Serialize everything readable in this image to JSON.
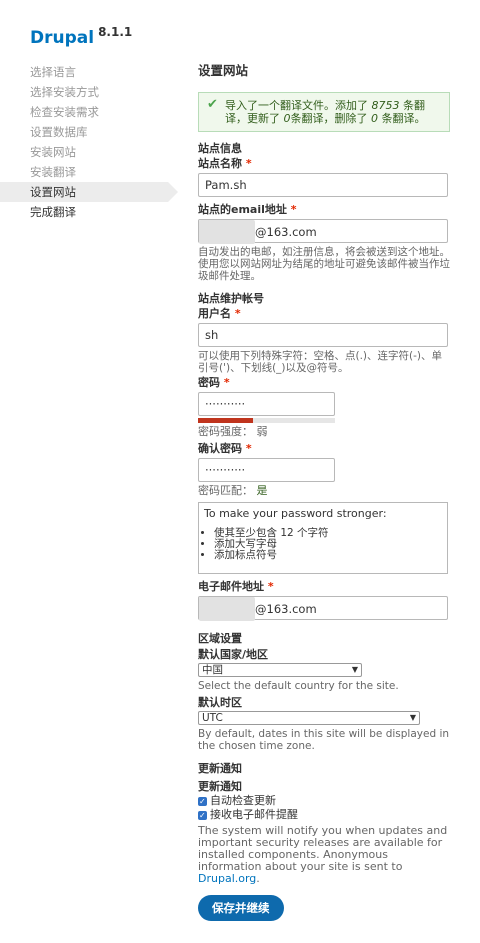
{
  "brand": {
    "name": "Drupal",
    "version": "8.1.1"
  },
  "steps": [
    {
      "label": "选择语言",
      "state": "done"
    },
    {
      "label": "选择安装方式",
      "state": "done"
    },
    {
      "label": "检查安装需求",
      "state": "done"
    },
    {
      "label": "设置数据库",
      "state": "done"
    },
    {
      "label": "安装网站",
      "state": "done"
    },
    {
      "label": "安装翻译",
      "state": "done"
    },
    {
      "label": "设置网站",
      "state": "active"
    },
    {
      "label": "完成翻译",
      "state": "todo"
    }
  ],
  "page": {
    "title": "设置网站"
  },
  "message": {
    "part1": "导入了一个翻译文件。添加了 ",
    "added": "8753",
    "part2": " 条翻译，更新了 ",
    "updated": "0",
    "part3": "条翻译，删除了 ",
    "deleted": "0",
    "part4": " 条翻译。"
  },
  "site_info": {
    "section": "站点信息",
    "name_label": "站点名称",
    "name_value": "Pam.sh",
    "email_label": "站点的email地址",
    "email_value": "@163.com",
    "email_desc": "自动发出的电邮，如注册信息，将会被送到这个地址。使用您以网站网址为结尾的地址可避免该邮件被当作垃圾邮件处理。"
  },
  "account": {
    "section": "站点维护帐号",
    "username_label": "用户名",
    "username_value": "sh",
    "username_desc": "可以使用下列特殊字符：空格、点(.)、连字符(-)、单引号(')、下划线(_)以及@符号。",
    "password_label": "密码",
    "password_value": "···········",
    "strength_label": "密码强度：",
    "strength_value": "弱",
    "strength_fraction": 0.4,
    "confirm_label": "确认密码",
    "confirm_value": "···········",
    "match_label": "密码匹配：",
    "match_value": "是",
    "tips_title": "To make your password stronger:",
    "tips": [
      "使其至少包含 12 个字符",
      "添加大写字母",
      "添加标点符号"
    ],
    "email_label": "电子邮件地址",
    "email_value": "@163.com"
  },
  "regional": {
    "section": "区域设置",
    "country_label": "默认国家/地区",
    "country_value": "中国",
    "country_desc": "Select the default country for the site.",
    "timezone_label": "默认时区",
    "timezone_value": "UTC",
    "timezone_desc": "By default, dates in this site will be displayed in the chosen time zone."
  },
  "updates": {
    "section": "更新通知",
    "label": "更新通知",
    "check_label": "自动检查更新",
    "email_label": "接收电子邮件提醒",
    "desc_before": "The system will notify you when updates and important security releases are available for installed components. Anonymous information about your site is sent to ",
    "desc_link": "Drupal.org",
    "desc_after": "."
  },
  "submit_label": "保存并继续",
  "colors": {
    "brand": "#0074bd",
    "required": "#e32700",
    "button": "#0e6aad",
    "status_ok": "#4ca44c"
  }
}
